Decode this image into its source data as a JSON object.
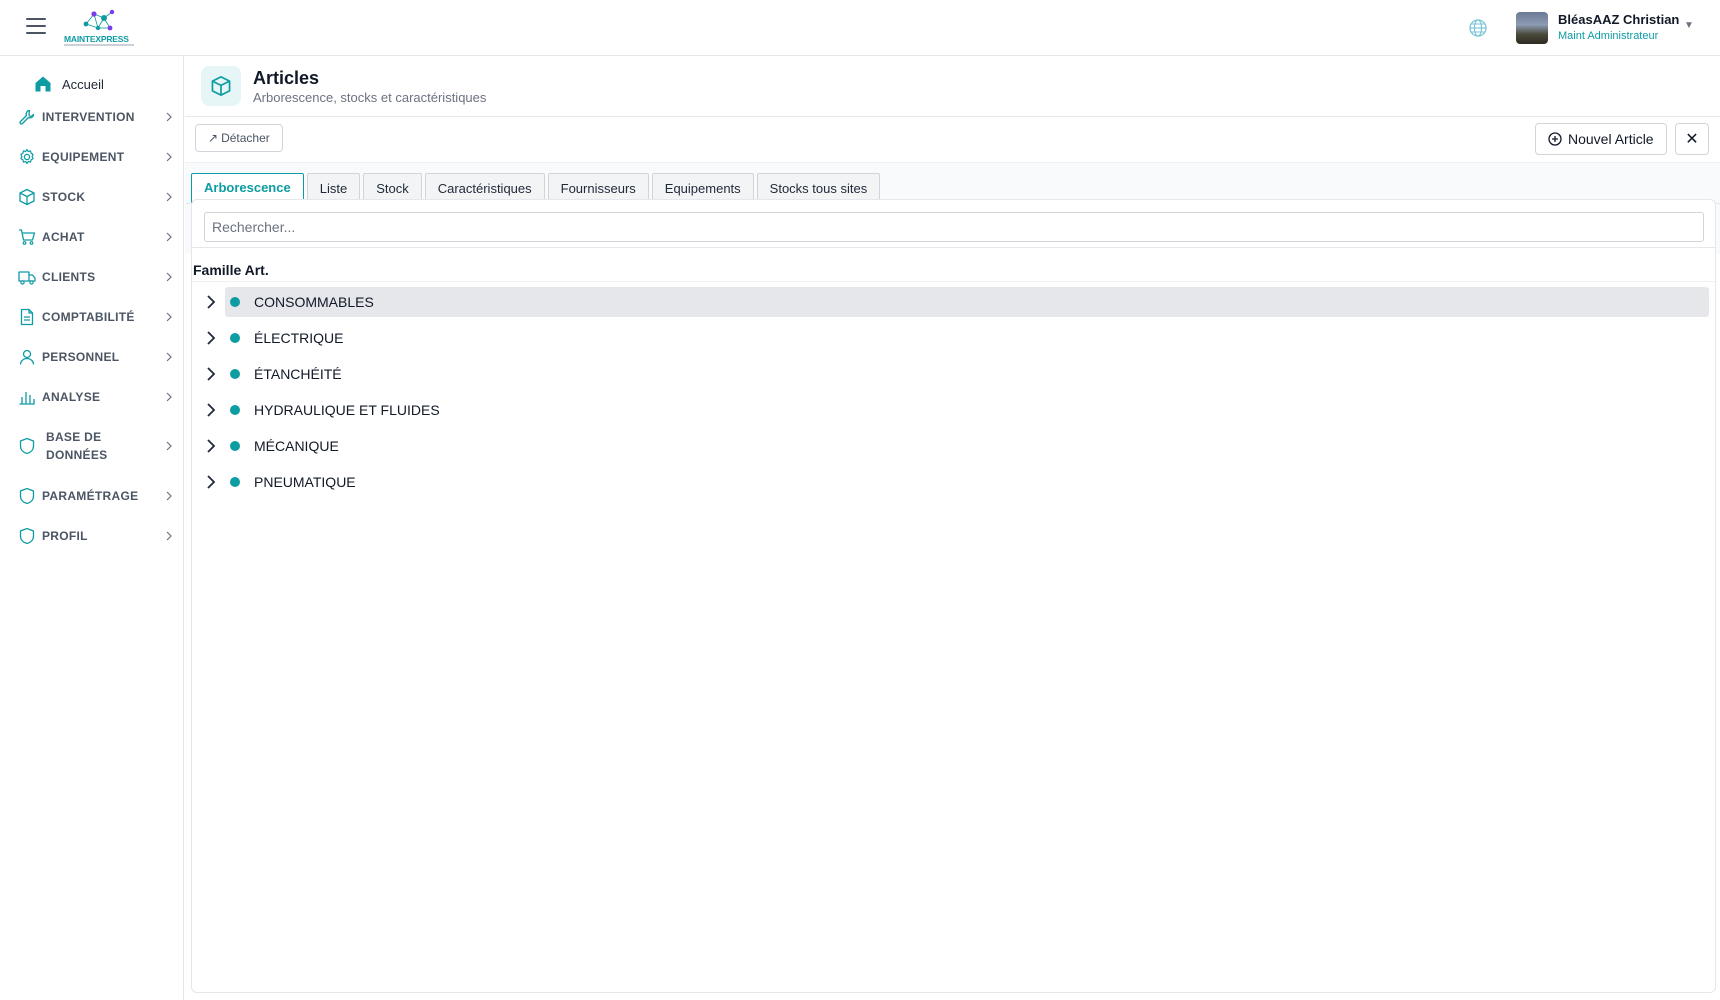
{
  "app": {
    "logo_text": "MAINTEXPRESS"
  },
  "user": {
    "name": "BléasAAZ Christian",
    "role": "Maint Administrateur"
  },
  "sidebar": {
    "home_label": "Accueil",
    "items": [
      {
        "label": "INTERVENTION",
        "icon": "wrench-icon"
      },
      {
        "label": "EQUIPEMENT",
        "icon": "gear-icon"
      },
      {
        "label": "STOCK",
        "icon": "box-icon"
      },
      {
        "label": "ACHAT",
        "icon": "cart-icon"
      },
      {
        "label": "CLIENTS",
        "icon": "truck-icon"
      },
      {
        "label": "COMPTABILITÉ",
        "icon": "document-icon"
      },
      {
        "label": "PERSONNEL",
        "icon": "user-icon"
      },
      {
        "label": "ANALYSE",
        "icon": "bar-chart-icon"
      },
      {
        "label": "BASE DE DONNÉES",
        "icon": "shield-icon"
      },
      {
        "label": "PARAMÉTRAGE",
        "icon": "shield-icon"
      },
      {
        "label": "PROFIL",
        "icon": "shield-icon"
      }
    ]
  },
  "page": {
    "title": "Articles",
    "subtitle": "Arborescence, stocks et caractéristiques"
  },
  "toolbar": {
    "detach_label": "Détacher",
    "new_article_label": "Nouvel Article"
  },
  "tabs": [
    {
      "label": "Arborescence",
      "active": true
    },
    {
      "label": "Liste"
    },
    {
      "label": "Stock"
    },
    {
      "label": "Caractéristiques"
    },
    {
      "label": "Fournisseurs"
    },
    {
      "label": "Equipements"
    },
    {
      "label": "Stocks tous sites"
    }
  ],
  "search": {
    "placeholder": "Rechercher..."
  },
  "tree": {
    "column_header": "Famille Art.",
    "items": [
      {
        "label": "CONSOMMABLES",
        "selected": true
      },
      {
        "label": "ÉLECTRIQUE"
      },
      {
        "label": "ÉTANCHÉITÉ"
      },
      {
        "label": "HYDRAULIQUE ET FLUIDES"
      },
      {
        "label": "MÉCANIQUE"
      },
      {
        "label": "PNEUMATIQUE"
      }
    ]
  },
  "colors": {
    "accent": "#0e9ca3",
    "selected_row": "#e5e7eb"
  }
}
